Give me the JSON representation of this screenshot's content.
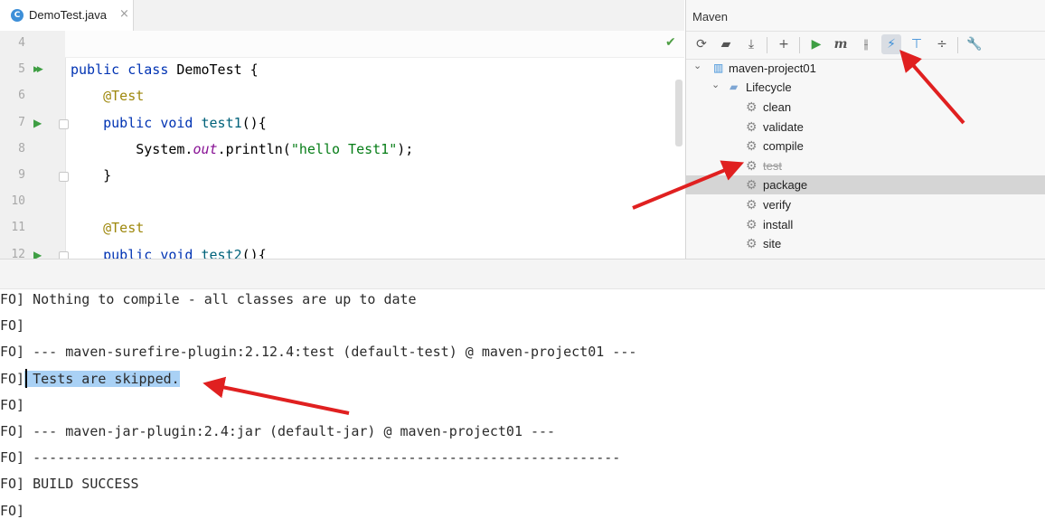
{
  "editor": {
    "tab": {
      "label": "DemoTest.java",
      "icon": "java-class-icon",
      "close": "×"
    },
    "lines": [
      {
        "number": "4",
        "tokens": []
      },
      {
        "number": "5",
        "tokens": [
          [
            "kw",
            "public "
          ],
          [
            "kw",
            "class "
          ],
          [
            "plain",
            "DemoTest {"
          ]
        ]
      },
      {
        "number": "6",
        "tokens": [
          [
            "plain",
            "    "
          ],
          [
            "ann",
            "@Test"
          ]
        ]
      },
      {
        "number": "7",
        "tokens": [
          [
            "plain",
            "    "
          ],
          [
            "kw",
            "public "
          ],
          [
            "kw",
            "void "
          ],
          [
            "fn",
            "test1"
          ],
          [
            "plain",
            "(){"
          ]
        ]
      },
      {
        "number": "8",
        "tokens": [
          [
            "plain",
            "        System."
          ],
          [
            "field",
            "out"
          ],
          [
            "plain",
            ".println("
          ],
          [
            "str",
            "\"hello Test1\""
          ],
          [
            "plain",
            ");"
          ]
        ]
      },
      {
        "number": "9",
        "tokens": [
          [
            "plain",
            "    }"
          ]
        ]
      },
      {
        "number": "10",
        "tokens": []
      },
      {
        "number": "11",
        "tokens": [
          [
            "plain",
            "    "
          ],
          [
            "ann",
            "@Test"
          ]
        ]
      },
      {
        "number": "12",
        "tokens": [
          [
            "plain",
            "    "
          ],
          [
            "kw",
            "public "
          ],
          [
            "kw",
            "void "
          ],
          [
            "fn",
            "test2"
          ],
          [
            "plain",
            "(){"
          ]
        ]
      }
    ]
  },
  "maven": {
    "title": "Maven",
    "toolbar": [
      "reload-icon",
      "add-folder-icon",
      "download-icon",
      "plus-icon",
      "run-icon",
      "maven-goal-icon",
      "toggle-offline-icon",
      "skip-tests-icon",
      "show-deps-icon",
      "collapse-icon",
      "settings-icon"
    ],
    "project": "maven-project01",
    "lifecycle_label": "Lifecycle",
    "lifecycle": [
      "clean",
      "validate",
      "compile",
      "test",
      "package",
      "verify",
      "install",
      "site"
    ],
    "selected": "package",
    "skipped": "test"
  },
  "console": {
    "lines": [
      "FO] Nothing to compile - all classes are up to date",
      "FO]",
      "FO] --- maven-surefire-plugin:2.12.4:test (default-test) @ maven-project01 ---",
      "FO] Tests are skipped.",
      "FO]",
      "FO] --- maven-jar-plugin:2.4:jar (default-jar) @ maven-project01 ---",
      "FO] ------------------------------------------------------------------------",
      "FO] BUILD SUCCESS",
      "FO]"
    ],
    "highlight_prefix": "FO]",
    "highlight_text": " Tests are skipped."
  },
  "colors": {
    "accent": "#3d8fd8",
    "arrow": "#e02020",
    "selection": "#a9d1f5"
  }
}
